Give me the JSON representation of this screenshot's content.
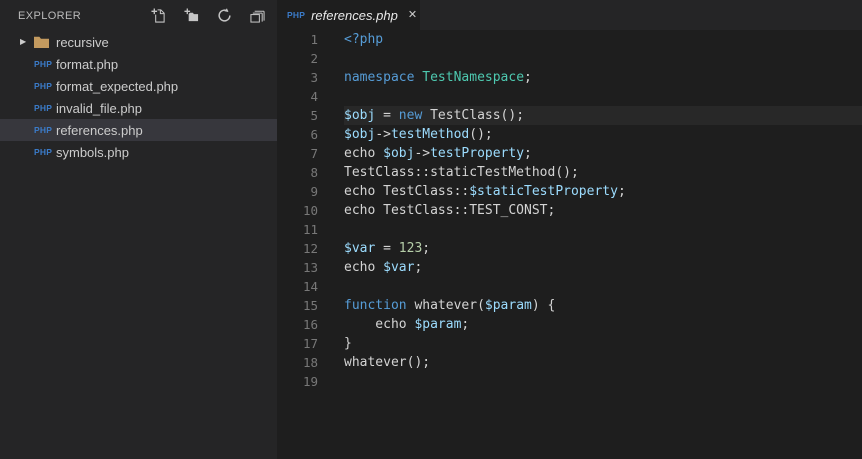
{
  "php_badge_text": "PHP",
  "colors": {
    "sidebar_bg": "#252526",
    "editor_bg": "#1E1E1E",
    "tabbar_bg": "#252526",
    "selection_bg": "#37373D",
    "line_highlight": "#282828",
    "keyword": "#569CD6",
    "type": "#4EC9B0",
    "variable": "#9CDCFE",
    "number": "#B5CEA8",
    "plain": "#D4D4D4",
    "line_number": "#787878",
    "php_badge": "#3B7BC8",
    "folder_icon": "#C39A5F",
    "toolbar_icon": "#C5C5C5"
  },
  "sidebar": {
    "title": "EXPLORER",
    "toolbar_icons": [
      "new-file-icon",
      "new-folder-icon",
      "refresh-icon",
      "collapse-all-icon"
    ],
    "items": [
      {
        "label": "recursive",
        "type": "folder",
        "selected": false
      },
      {
        "label": "format.php",
        "type": "php",
        "selected": false
      },
      {
        "label": "format_expected.php",
        "type": "php",
        "selected": false
      },
      {
        "label": "invalid_file.php",
        "type": "php",
        "selected": false
      },
      {
        "label": "references.php",
        "type": "php",
        "selected": true
      },
      {
        "label": "symbols.php",
        "type": "php",
        "selected": false
      }
    ]
  },
  "tab": {
    "label": "references.php",
    "close": "✕"
  },
  "editor": {
    "current_line": 5,
    "lines": [
      {
        "n": 1,
        "tokens": [
          {
            "t": "<?php",
            "c": "keyword"
          }
        ]
      },
      {
        "n": 2,
        "tokens": []
      },
      {
        "n": 3,
        "tokens": [
          {
            "t": "namespace",
            "c": "keyword"
          },
          {
            "t": " ",
            "c": "plain"
          },
          {
            "t": "TestNamespace",
            "c": "type"
          },
          {
            "t": ";",
            "c": "plain"
          }
        ]
      },
      {
        "n": 4,
        "tokens": []
      },
      {
        "n": 5,
        "tokens": [
          {
            "t": "$obj",
            "c": "variable"
          },
          {
            "t": " = ",
            "c": "plain"
          },
          {
            "t": "new",
            "c": "keyword"
          },
          {
            "t": " TestClass();",
            "c": "plain"
          }
        ]
      },
      {
        "n": 6,
        "tokens": [
          {
            "t": "$obj",
            "c": "variable"
          },
          {
            "t": "->",
            "c": "plain"
          },
          {
            "t": "testMethod",
            "c": "variable"
          },
          {
            "t": "();",
            "c": "plain"
          }
        ]
      },
      {
        "n": 7,
        "tokens": [
          {
            "t": "echo ",
            "c": "plain"
          },
          {
            "t": "$obj",
            "c": "variable"
          },
          {
            "t": "->",
            "c": "plain"
          },
          {
            "t": "testProperty",
            "c": "variable"
          },
          {
            "t": ";",
            "c": "plain"
          }
        ]
      },
      {
        "n": 8,
        "tokens": [
          {
            "t": "TestClass::staticTestMethod();",
            "c": "plain"
          }
        ]
      },
      {
        "n": 9,
        "tokens": [
          {
            "t": "echo TestClass::",
            "c": "plain"
          },
          {
            "t": "$staticTestProperty",
            "c": "variable"
          },
          {
            "t": ";",
            "c": "plain"
          }
        ]
      },
      {
        "n": 10,
        "tokens": [
          {
            "t": "echo TestClass::TEST_CONST;",
            "c": "plain"
          }
        ]
      },
      {
        "n": 11,
        "tokens": []
      },
      {
        "n": 12,
        "tokens": [
          {
            "t": "$var",
            "c": "variable"
          },
          {
            "t": " = ",
            "c": "plain"
          },
          {
            "t": "123",
            "c": "number"
          },
          {
            "t": ";",
            "c": "plain"
          }
        ]
      },
      {
        "n": 13,
        "tokens": [
          {
            "t": "echo ",
            "c": "plain"
          },
          {
            "t": "$var",
            "c": "variable"
          },
          {
            "t": ";",
            "c": "plain"
          }
        ]
      },
      {
        "n": 14,
        "tokens": []
      },
      {
        "n": 15,
        "tokens": [
          {
            "t": "function",
            "c": "keyword"
          },
          {
            "t": " whatever(",
            "c": "plain"
          },
          {
            "t": "$param",
            "c": "variable"
          },
          {
            "t": ") {",
            "c": "plain"
          }
        ]
      },
      {
        "n": 16,
        "tokens": [
          {
            "t": "    echo ",
            "c": "plain"
          },
          {
            "t": "$param",
            "c": "variable"
          },
          {
            "t": ";",
            "c": "plain"
          }
        ]
      },
      {
        "n": 17,
        "tokens": [
          {
            "t": "}",
            "c": "plain"
          }
        ]
      },
      {
        "n": 18,
        "tokens": [
          {
            "t": "whatever();",
            "c": "plain"
          }
        ]
      },
      {
        "n": 19,
        "tokens": []
      }
    ]
  }
}
